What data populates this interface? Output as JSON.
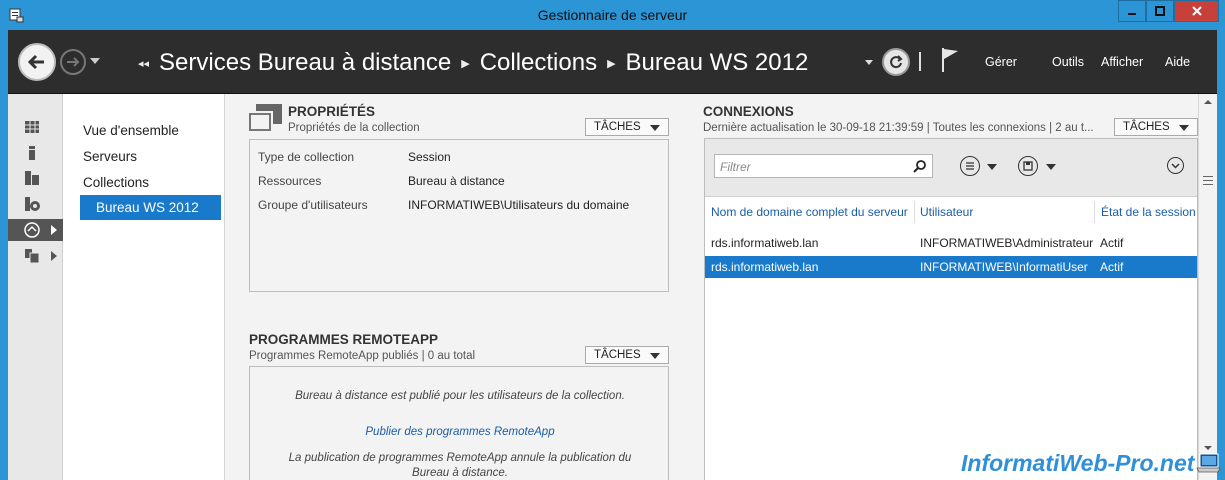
{
  "window": {
    "title": "Gestionnaire de serveur",
    "accent": "#2b95d6",
    "close_color": "#c7403a"
  },
  "header": {
    "breadcrumb": [
      "Services Bureau à distance",
      "Collections",
      "Bureau WS 2012"
    ],
    "menu": [
      "Gérer",
      "Outils",
      "Afficher",
      "Aide"
    ],
    "icons": [
      "back-icon",
      "forward-icon",
      "refresh-icon",
      "flag-icon"
    ]
  },
  "strip": {
    "icons": [
      "dashboard-icon",
      "local-server-icon",
      "all-servers-icon",
      "file-services-icon",
      "remote-desktop-icon",
      "roles-icon"
    ]
  },
  "nav": {
    "items": [
      "Vue d'ensemble",
      "Serveurs",
      "Collections",
      "Bureau WS 2012"
    ],
    "selected": "Bureau WS 2012"
  },
  "properties": {
    "title": "PROPRIÉTÉS",
    "subtitle": "Propriétés de la collection",
    "tasks_label": "TÂCHES",
    "rows": [
      {
        "label": "Type de collection",
        "value": "Session"
      },
      {
        "label": "Ressources",
        "value": "Bureau à distance"
      },
      {
        "label": "Groupe d'utilisateurs",
        "value": "INFORMATIWEB\\Utilisateurs du domaine"
      }
    ]
  },
  "remoteapp": {
    "title": "PROGRAMMES REMOTEAPP",
    "subtitle": "Programmes RemoteApp publiés | 0 au total",
    "tasks_label": "TÂCHES",
    "message": "Bureau à distance est publié pour les utilisateurs de la collection.",
    "link": "Publier des programmes RemoteApp",
    "note_line1": "La publication de programmes RemoteApp annule la publication du",
    "note_line2": "Bureau à distance."
  },
  "connections": {
    "title": "CONNEXIONS",
    "subtitle": "Dernière actualisation le 30-09-18 21:39:59 | Toutes les connexions | 2 au t...",
    "tasks_label": "TÂCHES",
    "filter_placeholder": "Filtrer",
    "columns": [
      "Nom de domaine complet du serveur",
      "Utilisateur",
      "État de la session"
    ],
    "rows": [
      {
        "server": "rds.informatiweb.lan",
        "user": "INFORMATIWEB\\Administrateur",
        "state": "Actif",
        "selected": false
      },
      {
        "server": "rds.informatiweb.lan",
        "user": "INFORMATIWEB\\InformatiUser",
        "state": "Actif",
        "selected": true
      }
    ]
  },
  "watermark": "InformatiWeb-Pro.net"
}
